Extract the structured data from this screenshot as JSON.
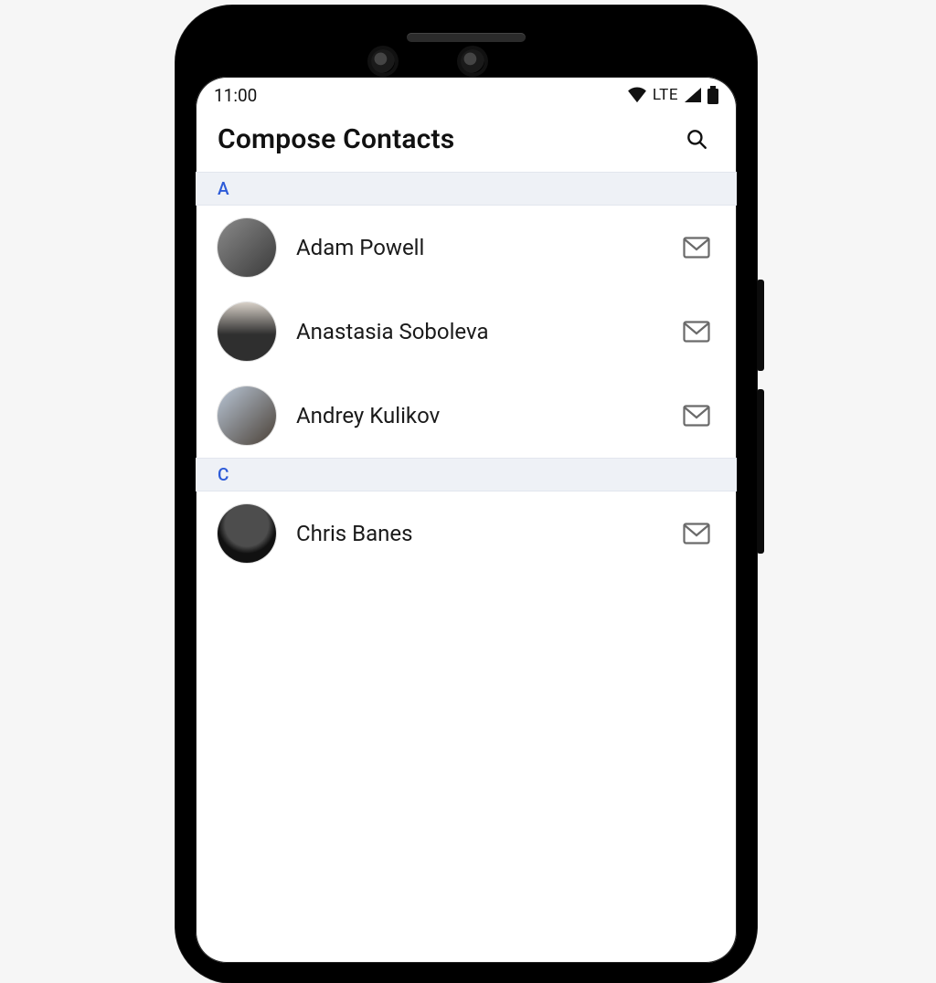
{
  "status": {
    "time": "11:00",
    "network_label": "LTE"
  },
  "toolbar": {
    "title": "Compose Contacts"
  },
  "sections": [
    {
      "letter": "A",
      "contacts": [
        {
          "name": "Adam Powell",
          "avatar_bg": "linear-gradient(135deg,#8a8a8a,#3a3a3a)"
        },
        {
          "name": "Anastasia Soboleva",
          "avatar_bg": "linear-gradient(180deg,#d7d0c7,#2f2f2f 55%)"
        },
        {
          "name": "Andrey Kulikov",
          "avatar_bg": "linear-gradient(135deg,#b9c6d6,#4a4036)"
        }
      ]
    },
    {
      "letter": "C",
      "contacts": [
        {
          "name": "Chris Banes",
          "avatar_bg": "radial-gradient(circle at 50% 35%,#4d4d4d 0 45%,#111 60%)"
        }
      ]
    }
  ]
}
